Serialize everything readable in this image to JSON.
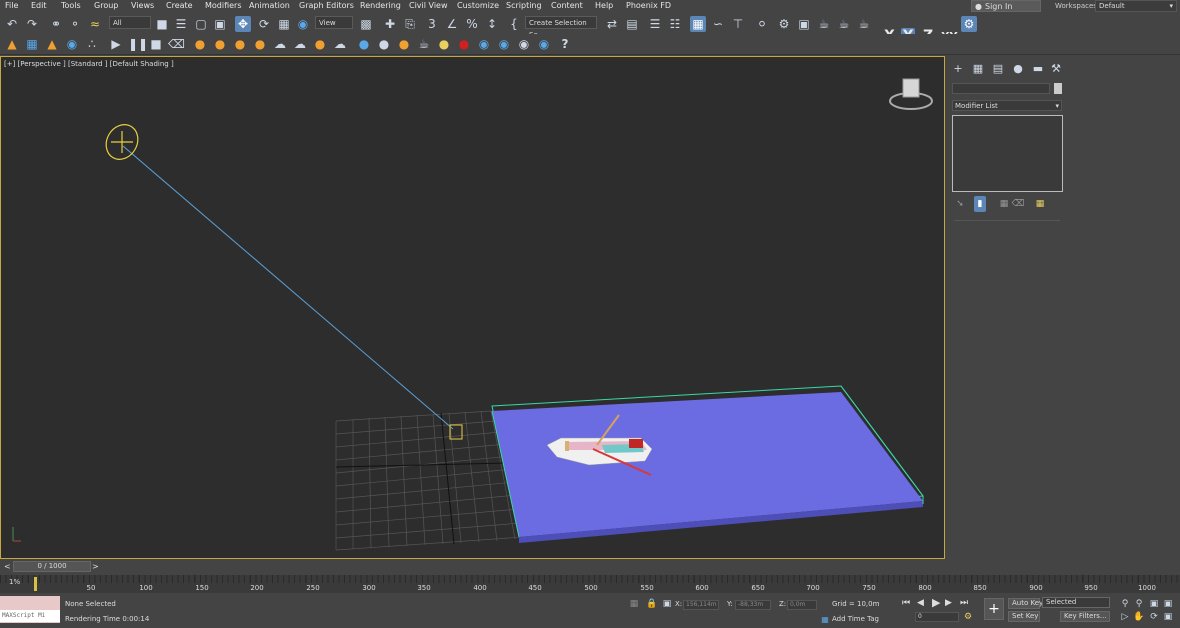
{
  "menubar": {
    "items": [
      "File",
      "Edit",
      "Tools",
      "Group",
      "Views",
      "Create",
      "Modifiers",
      "Animation",
      "Graph Editors",
      "Rendering",
      "Civil View",
      "Customize",
      "Scripting",
      "Content",
      "Help",
      "Phoenix FD"
    ],
    "sign_in": "Sign In",
    "workspaces_label": "Workspaces:",
    "workspace_value": "Default"
  },
  "toolbar": {
    "selection_filter": "All",
    "reference_coord": "View",
    "selection_set": "Create Selection Se",
    "axis_x": "X",
    "axis_y": "Y",
    "axis_z": "Z",
    "axis_xy": "XY"
  },
  "viewport": {
    "label": "[+] [Perspective ] [Standard ] [Default Shading ]"
  },
  "command_panel": {
    "modifier_list": "Modifier List"
  },
  "timeline": {
    "frame_display": "0 / 1000",
    "prev": "<",
    "next": ">",
    "ticks": [
      "50",
      "100",
      "150",
      "200",
      "250",
      "300",
      "350",
      "400",
      "450",
      "500",
      "550",
      "600",
      "650",
      "700",
      "750",
      "800",
      "850",
      "900",
      "950",
      "1000"
    ],
    "start_marker": "1%"
  },
  "status": {
    "maxscript_label": "MAXScript Mi",
    "selection": "None Selected",
    "render_time": "Rendering Time  0:00:14",
    "x_label": "X:",
    "x_value": "156,114m",
    "y_label": "Y:",
    "y_value": "-88,33m",
    "z_label": "Z:",
    "z_value": "0,0m",
    "grid": "Grid = 10,0m",
    "add_time_tag": "Add Time Tag",
    "auto_key": "Auto Key",
    "selected": "Selected",
    "set_key": "Set Key",
    "key_filters": "Key Filters...",
    "frame_field": "0"
  },
  "colors": {
    "viewport_border": "#c8a640",
    "water_fill": "#6c6ce2",
    "selection_bracket": "#3ad8a8",
    "light_gizmo": "#e8d040",
    "light_line": "#5aa0d8",
    "active_tool": "#5b86b6"
  }
}
